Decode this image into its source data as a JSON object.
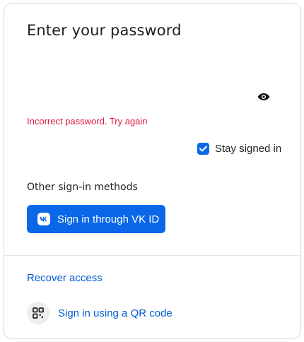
{
  "form": {
    "title": "Enter your password",
    "password": {
      "value": "",
      "placeholder": ""
    },
    "icons": {
      "toggle_visibility": "eye-icon"
    },
    "error": "Incorrect password. Try again",
    "stay_signed_in": {
      "label": "Stay signed in",
      "checked": true
    }
  },
  "other_methods": {
    "heading": "Other sign-in methods",
    "vk_button": {
      "label": "Sign in through VK ID",
      "icon": "vk-logo-icon"
    }
  },
  "footer": {
    "recover_link": "Recover access",
    "qr_link": {
      "label": "Sign in using a QR code",
      "icon": "qr-code-icon"
    }
  },
  "colors": {
    "accent": "#0a67e8",
    "link": "#005bd1",
    "error": "#e0163d",
    "text": "#1f1f1f"
  }
}
